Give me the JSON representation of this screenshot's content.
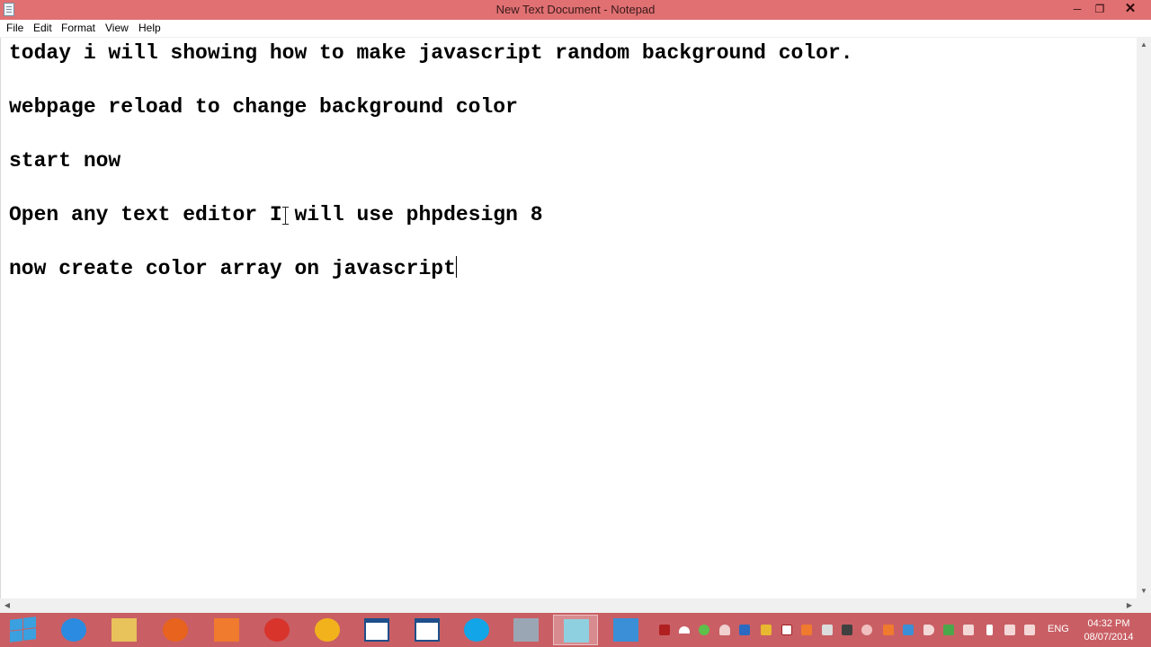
{
  "window": {
    "title": "New Text Document - Notepad",
    "minimize_glyph": "─",
    "maximize_glyph": "❐",
    "close_glyph": "✕"
  },
  "menu": {
    "file": "File",
    "edit": "Edit",
    "format": "Format",
    "view": "View",
    "help": "Help"
  },
  "document": {
    "lines": [
      "today i will showing how to make javascript random background color.",
      "webpage reload to change background color",
      "start now",
      "Open any text editor I will use phpdesign 8",
      "now create color array on javascript"
    ]
  },
  "taskbar": {
    "apps": [
      {
        "name": "internet-explorer-icon",
        "color": "#2b8be0"
      },
      {
        "name": "file-explorer-icon",
        "color": "#e8c25a"
      },
      {
        "name": "firefox-icon",
        "color": "#e8631e"
      },
      {
        "name": "xampp-icon",
        "color": "#f07a2e"
      },
      {
        "name": "chrome-icon",
        "color": "#d8342c"
      },
      {
        "name": "chrome-canary-icon",
        "color": "#f2b21c"
      },
      {
        "name": "window-icon",
        "color": "#ffffff"
      },
      {
        "name": "window-icon",
        "color": "#ffffff"
      },
      {
        "name": "skype-icon",
        "color": "#12a5e8"
      },
      {
        "name": "media-player-icon",
        "color": "#9aa6b4"
      },
      {
        "name": "notepad-icon",
        "color": "#8fd0e0"
      },
      {
        "name": "document-icon",
        "color": "#3a8fd6"
      }
    ],
    "language": "ENG",
    "time": "04:32 PM",
    "date": "08/07/2014"
  },
  "colors": {
    "titlebar": "#e07072",
    "taskbar": "#c95f64",
    "text": "#000000"
  }
}
